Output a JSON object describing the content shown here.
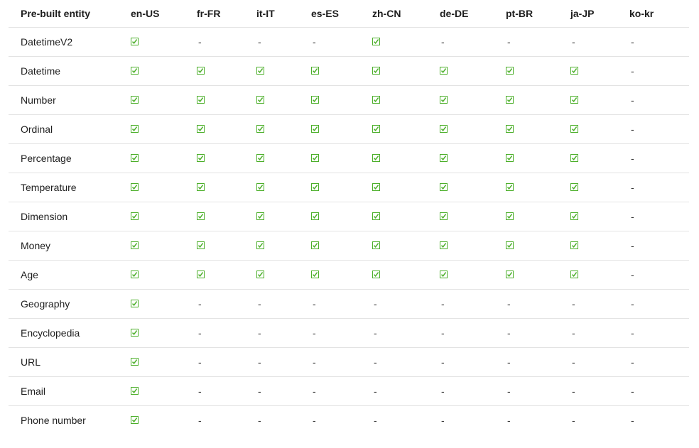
{
  "columns": [
    "Pre-built entity",
    "en-US",
    "fr-FR",
    "it-IT",
    "es-ES",
    "zh-CN",
    "de-DE",
    "pt-BR",
    "ja-JP",
    "ko-kr"
  ],
  "rows": [
    {
      "entity": "DatetimeV2",
      "support": [
        true,
        false,
        false,
        false,
        true,
        false,
        false,
        false,
        false
      ]
    },
    {
      "entity": "Datetime",
      "support": [
        true,
        true,
        true,
        true,
        true,
        true,
        true,
        true,
        false
      ]
    },
    {
      "entity": "Number",
      "support": [
        true,
        true,
        true,
        true,
        true,
        true,
        true,
        true,
        false
      ]
    },
    {
      "entity": "Ordinal",
      "support": [
        true,
        true,
        true,
        true,
        true,
        true,
        true,
        true,
        false
      ]
    },
    {
      "entity": "Percentage",
      "support": [
        true,
        true,
        true,
        true,
        true,
        true,
        true,
        true,
        false
      ]
    },
    {
      "entity": "Temperature",
      "support": [
        true,
        true,
        true,
        true,
        true,
        true,
        true,
        true,
        false
      ]
    },
    {
      "entity": "Dimension",
      "support": [
        true,
        true,
        true,
        true,
        true,
        true,
        true,
        true,
        false
      ]
    },
    {
      "entity": "Money",
      "support": [
        true,
        true,
        true,
        true,
        true,
        true,
        true,
        true,
        false
      ]
    },
    {
      "entity": "Age",
      "support": [
        true,
        true,
        true,
        true,
        true,
        true,
        true,
        true,
        false
      ]
    },
    {
      "entity": "Geography",
      "support": [
        true,
        false,
        false,
        false,
        false,
        false,
        false,
        false,
        false
      ]
    },
    {
      "entity": "Encyclopedia",
      "support": [
        true,
        false,
        false,
        false,
        false,
        false,
        false,
        false,
        false
      ]
    },
    {
      "entity": "URL",
      "support": [
        true,
        false,
        false,
        false,
        false,
        false,
        false,
        false,
        false
      ]
    },
    {
      "entity": "Email",
      "support": [
        true,
        false,
        false,
        false,
        false,
        false,
        false,
        false,
        false
      ]
    },
    {
      "entity": "Phone number",
      "support": [
        true,
        false,
        false,
        false,
        false,
        false,
        false,
        false,
        false
      ]
    }
  ],
  "unsupported_text": "-",
  "icons": {
    "supported": "check-icon"
  },
  "colors": {
    "check": "#4caf2a",
    "divider": "#e3e3e3"
  }
}
